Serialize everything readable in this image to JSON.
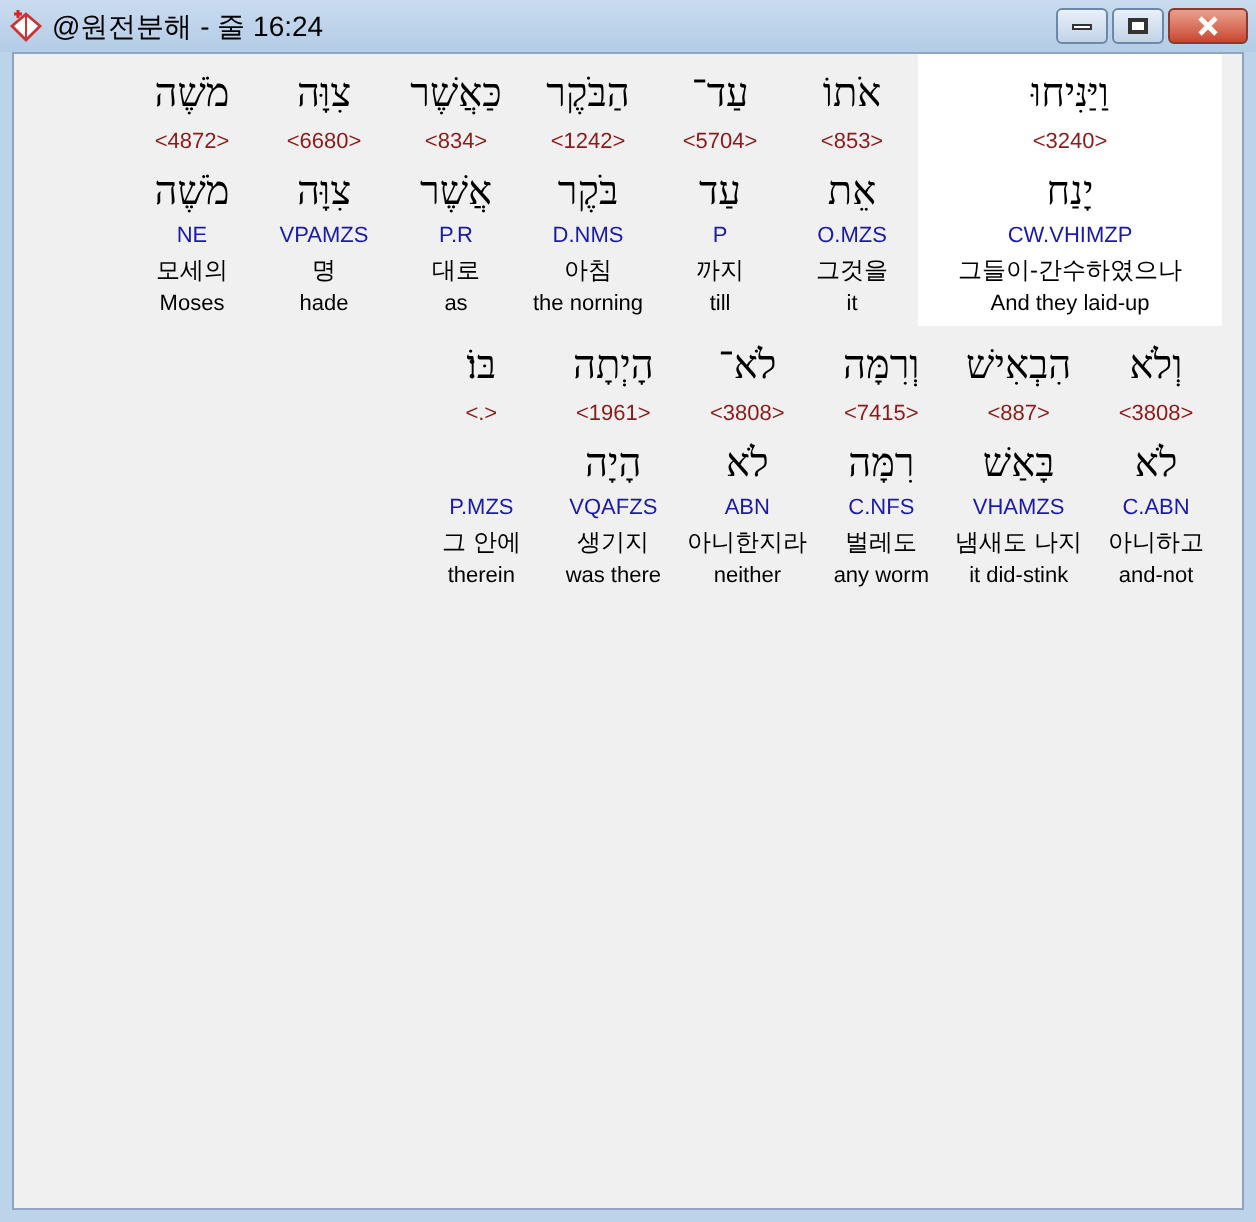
{
  "window": {
    "title": "@원전분해 - 줄 16:24"
  },
  "words": [
    {
      "hebrew": "וַיַּנִּיחוּ",
      "strong": "<3240>",
      "lemma": "יָנַח",
      "parsing": "CW.VHIMZP",
      "korean": "그들이-간수하였으나",
      "english": "And they laid-up",
      "selected": true
    },
    {
      "hebrew": "אֹתוֹ",
      "strong": "<853>",
      "lemma": "אֵת",
      "parsing": "O.MZS",
      "korean": "그것을",
      "english": "it",
      "selected": false
    },
    {
      "hebrew": "עַד־",
      "strong": "<5704>",
      "lemma": "עַד",
      "parsing": "P",
      "korean": "까지",
      "english": "till",
      "selected": false
    },
    {
      "hebrew": "הַבֹּקֶר",
      "strong": "<1242>",
      "lemma": "בֹּקֶר",
      "parsing": "D.NMS",
      "korean": "아침",
      "english": "the norning",
      "selected": false
    },
    {
      "hebrew": "כַּאֲשֶׁר",
      "strong": "<834>",
      "lemma": "אֲשֶׁר",
      "parsing": "P.R",
      "korean": "대로",
      "english": "as",
      "selected": false
    },
    {
      "hebrew": "צִוָּה",
      "strong": "<6680>",
      "lemma": "צִוָּה",
      "parsing": "VPAMZS",
      "korean": "명",
      "english": "hade",
      "selected": false
    },
    {
      "hebrew": "מֹשֶׁה",
      "strong": "<4872>",
      "lemma": "מֹשֶׁה",
      "parsing": "NE",
      "korean": "모세의",
      "english": "Moses",
      "selected": false
    },
    {
      "hebrew": "וְלֹא",
      "strong": "<3808>",
      "lemma": "לֹא",
      "parsing": "C.ABN",
      "korean": "아니하고",
      "english": "and-not",
      "selected": false
    },
    {
      "hebrew": "הִבְאִישׁ",
      "strong": "<887>",
      "lemma": "בָּאַשׁ",
      "parsing": "VHAMZS",
      "korean": "냄새도 나지",
      "english": "it did-stink",
      "selected": false
    },
    {
      "hebrew": "וְרִמָּה",
      "strong": "<7415>",
      "lemma": "רִמָּה",
      "parsing": "C.NFS",
      "korean": "벌레도",
      "english": "any worm",
      "selected": false
    },
    {
      "hebrew": "לֹא־",
      "strong": "<3808>",
      "lemma": "לֹא",
      "parsing": "ABN",
      "korean": "아니한지라",
      "english": "neither",
      "selected": false
    },
    {
      "hebrew": "הָיְתָה",
      "strong": "<1961>",
      "lemma": "הָיָה",
      "parsing": "VQAFZS",
      "korean": "생기지",
      "english": "was there",
      "selected": false
    },
    {
      "hebrew": "בּוֹ׃",
      "strong": "<.>",
      "parsing": "P.MZS",
      "korean": "그 안에",
      "english": "therein",
      "selected": false
    }
  ]
}
